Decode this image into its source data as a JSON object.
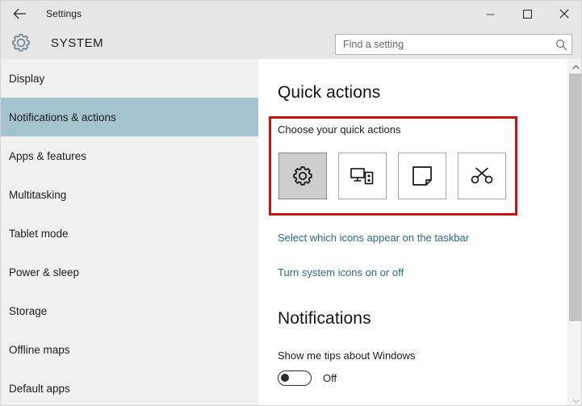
{
  "window": {
    "title": "Settings",
    "back_icon": "back-arrow-icon",
    "controls": {
      "minimize": "minimize-icon",
      "maximize": "maximize-icon",
      "close": "close-icon"
    }
  },
  "header": {
    "icon": "gear-icon",
    "title": "SYSTEM"
  },
  "search": {
    "placeholder": "Find a setting",
    "value": "",
    "icon": "search-icon"
  },
  "sidebar": {
    "items": [
      {
        "label": "Display",
        "selected": false
      },
      {
        "label": "Notifications & actions",
        "selected": true
      },
      {
        "label": "Apps & features",
        "selected": false
      },
      {
        "label": "Multitasking",
        "selected": false
      },
      {
        "label": "Tablet mode",
        "selected": false
      },
      {
        "label": "Power & sleep",
        "selected": false
      },
      {
        "label": "Storage",
        "selected": false
      },
      {
        "label": "Offline maps",
        "selected": false
      },
      {
        "label": "Default apps",
        "selected": false
      }
    ]
  },
  "content": {
    "quick_actions": {
      "title": "Quick actions",
      "subtitle": "Choose your quick actions",
      "highlight_color": "#cc1111",
      "tiles": [
        {
          "icon": "gear-icon",
          "selected": true
        },
        {
          "icon": "connect-display-icon",
          "selected": false
        },
        {
          "icon": "note-icon",
          "selected": false
        },
        {
          "icon": "scissors-snip-icon",
          "selected": false
        }
      ]
    },
    "links": [
      {
        "label": "Select which icons appear on the taskbar",
        "color": "#2b6a8f"
      },
      {
        "label": "Turn system icons on or off",
        "color": "#2b6a8f"
      }
    ],
    "notifications": {
      "title": "Notifications",
      "setting_label": "Show me tips about Windows",
      "toggle_state": "Off",
      "toggle_on": false
    }
  },
  "scrollbar": {
    "up_arrow": "chevron-up-icon",
    "down_arrow": "chevron-down-icon",
    "thumb": "scroll-thumb"
  }
}
